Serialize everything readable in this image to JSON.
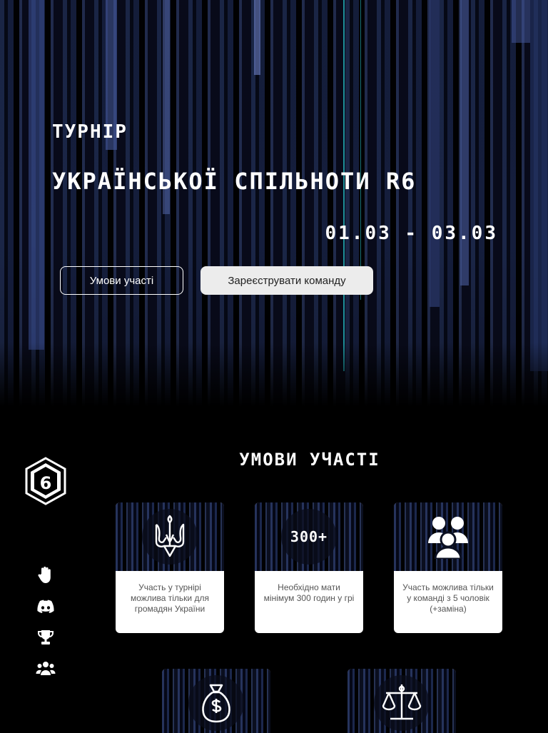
{
  "hero": {
    "subtitle": "ТУРНІР",
    "title": "УКРАЇНСЬКОЇ СПІЛЬНОТИ R6",
    "dates": "01.03 - 03.03",
    "btn_conditions": "Умови участі",
    "btn_register": "Зареєструвати команду"
  },
  "sidebar": {
    "logo": "rainbow-six-logo",
    "items": [
      {
        "icon": "hand-icon"
      },
      {
        "icon": "discord-icon"
      },
      {
        "icon": "trophy-icon"
      },
      {
        "icon": "users-icon"
      }
    ]
  },
  "conditions": {
    "title": "УМОВИ УЧАСТІ",
    "cards": [
      {
        "icon": "trident-icon",
        "text": "Участь у турнірі можлива тільки для громадян України"
      },
      {
        "icon_text": "300+",
        "text": "Необхідно мати мінімум 300 годин у грі"
      },
      {
        "icon": "group-icon",
        "text": "Участь можлива тільки у команді з 5 чоловік (+заміна)"
      },
      {
        "icon": "money-bag-icon"
      },
      {
        "icon": "scales-icon"
      }
    ]
  },
  "colors": {
    "background": "#000000",
    "hero_blue": "#1b2547",
    "button_light": "#ececec",
    "card_text": "#555555"
  }
}
